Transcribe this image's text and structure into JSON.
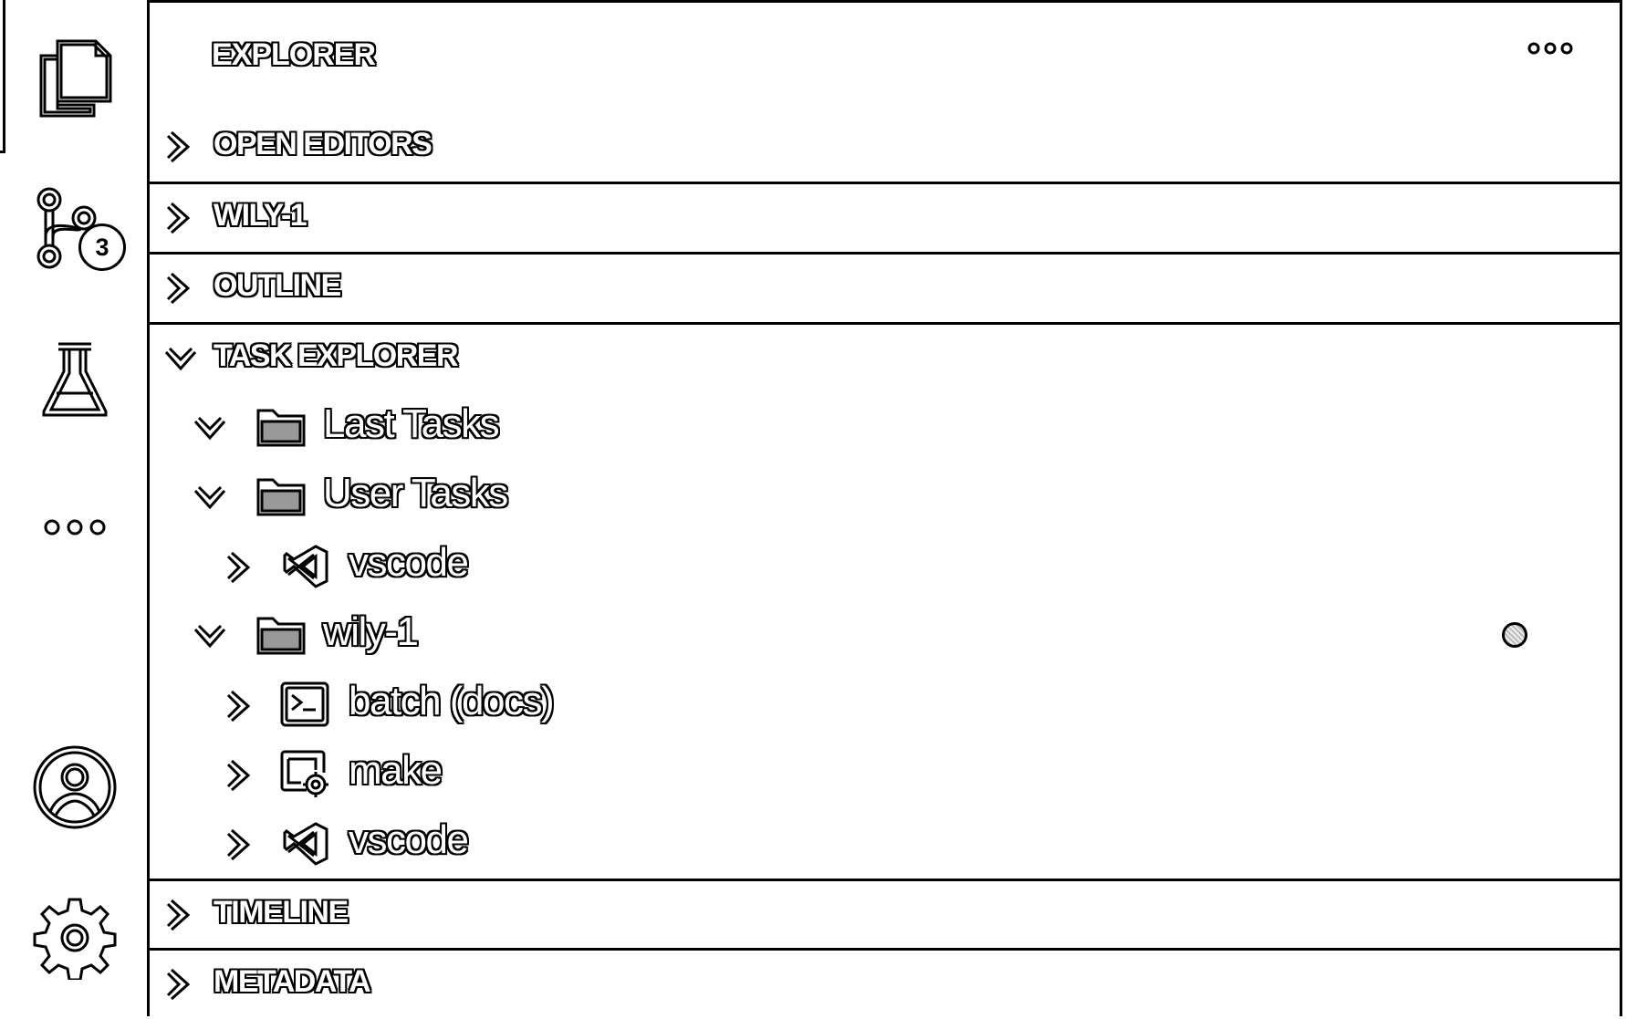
{
  "activity_bar": {
    "items": [
      {
        "name": "explorer",
        "icon": "files-icon",
        "active": true
      },
      {
        "name": "source-control",
        "icon": "source-control-icon",
        "badge": "3"
      },
      {
        "name": "testing",
        "icon": "flask-icon"
      },
      {
        "name": "more",
        "icon": "ellipsis-icon"
      },
      {
        "name": "accounts",
        "icon": "account-icon"
      },
      {
        "name": "manage",
        "icon": "gear-icon"
      }
    ]
  },
  "sidebar": {
    "title": "EXPLORER",
    "more_icon": "ellipsis-icon",
    "sections": [
      {
        "label": "OPEN EDITORS",
        "expanded": false
      },
      {
        "label": "WILY-1",
        "expanded": false
      },
      {
        "label": "OUTLINE",
        "expanded": false
      },
      {
        "label": "TASK EXPLORER",
        "expanded": true
      },
      {
        "label": "TIMELINE",
        "expanded": false
      },
      {
        "label": "METADATA",
        "expanded": false
      }
    ],
    "task_tree": [
      {
        "label": "Last Tasks",
        "icon": "folder-open-icon",
        "expanded": true,
        "level": 0
      },
      {
        "label": "User Tasks",
        "icon": "folder-open-icon",
        "expanded": true,
        "level": 0
      },
      {
        "label": "vscode",
        "icon": "vscode-icon",
        "expanded": false,
        "level": 1
      },
      {
        "label": "wily-1",
        "icon": "folder-open-icon",
        "expanded": true,
        "level": 0,
        "indicator": true
      },
      {
        "label": "batch (docs)",
        "icon": "terminal-icon",
        "expanded": false,
        "level": 1
      },
      {
        "label": "make",
        "icon": "settings-window-icon",
        "expanded": false,
        "level": 1
      },
      {
        "label": "vscode",
        "icon": "vscode-icon",
        "expanded": false,
        "level": 1
      }
    ]
  },
  "colors": {
    "foreground": "#000000",
    "background": "#ffffff"
  }
}
